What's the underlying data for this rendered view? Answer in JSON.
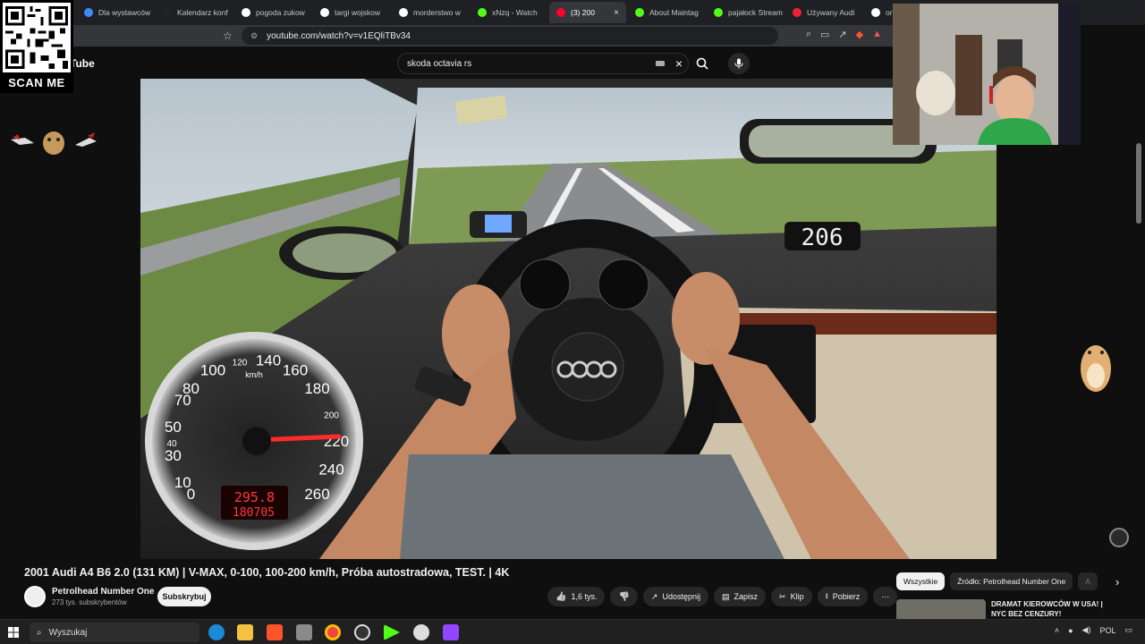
{
  "browser": {
    "tabs": [
      {
        "label": "Dla wystawców",
        "color": "#3d8af7"
      },
      {
        "label": "Kalendarz konf",
        "color": "#222"
      },
      {
        "label": "pogoda zukow",
        "color": "#ffffff"
      },
      {
        "label": "targi wojskow",
        "color": "#ffffff"
      },
      {
        "label": "morderstwo w",
        "color": "#ffffff"
      },
      {
        "label": "xNzq - Watch",
        "color": "#53fc18"
      },
      {
        "label": "(3) 200",
        "color": "#ff0033",
        "active": true
      },
      {
        "label": "About Maintag",
        "color": "#53fc18"
      },
      {
        "label": "pajałock Stream",
        "color": "#53fc18"
      },
      {
        "label": "Używany Audi",
        "color": "#e23"
      },
      {
        "label": "on",
        "color": "#ffffff"
      }
    ],
    "close_symbol": "×",
    "url": "youtube.com/watch?v=v1EQliTBv34"
  },
  "youtube": {
    "logo_text": "Tube",
    "search_query": "skoda octavia rs"
  },
  "qr": {
    "label": "SCAN ME"
  },
  "video": {
    "speedo_readout": "295.8",
    "odometer": "180705",
    "gps_display": "206",
    "speedo_ticks": [
      "0",
      "10",
      "30",
      "50",
      "70",
      "80",
      "100",
      "140",
      "160",
      "180",
      "220",
      "240",
      "260",
      "40",
      "120",
      "200"
    ],
    "speedo_unit": "km/h",
    "speed_needle_value": 295.8,
    "speedo_max": 260
  },
  "meta": {
    "title": "2001 Audi A4 B6 2.0 (131 KM) | V-MAX, 0-100, 100-200 km/h, Próba autostradowa, TEST. | 4K",
    "channel_name": "Petrolhead Number One",
    "subscribers": "273 tys. subskrybentów",
    "subscribe_label": "Subskrybuj",
    "likes": "1,6 tys.",
    "share": "Udostępnij",
    "save": "Zapisz",
    "clip": "Klip",
    "download": "Pobierz"
  },
  "sidebar": {
    "chips": [
      "Wszystkie",
      "Źródło: Petrolhead Number One",
      "A"
    ],
    "reco_title": "DRAMAT KIEROWCÓW W USA! | NYC BEZ CENZURY!"
  },
  "taskbar": {
    "search_placeholder": "Wyszukaj",
    "lang": "POL"
  },
  "icons": {
    "bookmark": "☆",
    "search": "⌕",
    "mic": "🎤",
    "like": "👍",
    "dislike": "👎",
    "share": "↗",
    "save": "▤",
    "clip": "✂",
    "download": "⭳",
    "more": "⋯",
    "chevron": "›"
  }
}
